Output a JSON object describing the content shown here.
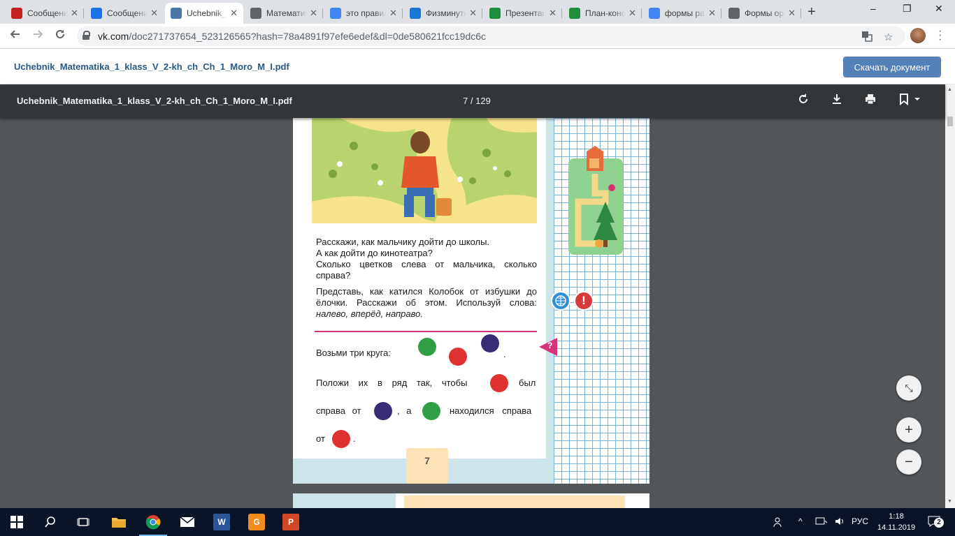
{
  "tabs": [
    {
      "title": "Сообщения",
      "icon": "red-square-icon",
      "color": "#c5221f"
    },
    {
      "title": "Сообщения",
      "icon": "blue-chat-icon",
      "color": "#1a73e8"
    },
    {
      "title": "Uchebnik_Matematika",
      "icon": "vk-icon",
      "color": "#4a76a8"
    },
    {
      "title": "Математика",
      "icon": "globe-icon",
      "color": "#5f6368"
    },
    {
      "title": "это правильно",
      "icon": "google-icon",
      "color": "#4285f4"
    },
    {
      "title": "Физминутки",
      "icon": "book-icon",
      "color": "#1976d2"
    },
    {
      "title": "Презентация",
      "icon": "check-icon",
      "color": "#1e8e3e"
    },
    {
      "title": "План-конспект",
      "icon": "check-icon",
      "color": "#1e8e3e"
    },
    {
      "title": "формы работы",
      "icon": "google-icon",
      "color": "#4285f4"
    },
    {
      "title": "Формы организации",
      "icon": "globe-icon",
      "color": "#5f6368"
    }
  ],
  "window": {
    "minimize": "–",
    "maximize": "❐",
    "close": "✕"
  },
  "address": {
    "domain": "vk.com",
    "path": "/doc271737654_523126565?hash=78a4891f97efe6edef&dl=0de580621fcc19dc6c"
  },
  "vk": {
    "filename": "Uchebnik_Matematika_1_klass_V_2-kh_ch_Ch_1_Moro_M_I.pdf",
    "download_label": "Скачать документ"
  },
  "pdf": {
    "title": "Uchebnik_Matematika_1_klass_V_2-kh_ch_Ch_1_Moro_M_I.pdf",
    "page_indicator": "7 / 129"
  },
  "page": {
    "p1": [
      "Расскажи, как мальчику дойти до школы.",
      "А как дойти до кинотеатра?",
      "Сколько цветков слева от мальчика, сколько справа?"
    ],
    "p2_text": "Представь, как катился Колобок от избушки до ёлочки. Расскажи об этом. Используй слова:",
    "p2_words": "налево, вперёд, направо.",
    "task1": "Возьми три круга:",
    "task1_end": ".",
    "task2_a": "Положи их в ряд так, чтобы",
    "task2_b": "был",
    "task2_c": "справа от",
    "task2_d": ", а",
    "task2_e": "находился справа",
    "task2_f": "от",
    "task2_end": ".",
    "page_number": "7",
    "question_mark": "?",
    "exclaim": "!"
  },
  "colors": {
    "green": "#2f9e44",
    "red": "#e03131",
    "purple": "#3b2c77",
    "pink": "#d6337a",
    "vk_blue": "#5181b8"
  },
  "fab": {
    "fit": "⤡",
    "zoom_in": "+",
    "zoom_out": "−"
  },
  "taskbar": {
    "language": "РУС",
    "time": "1:18",
    "date": "14.11.2019",
    "notifications": "2"
  }
}
